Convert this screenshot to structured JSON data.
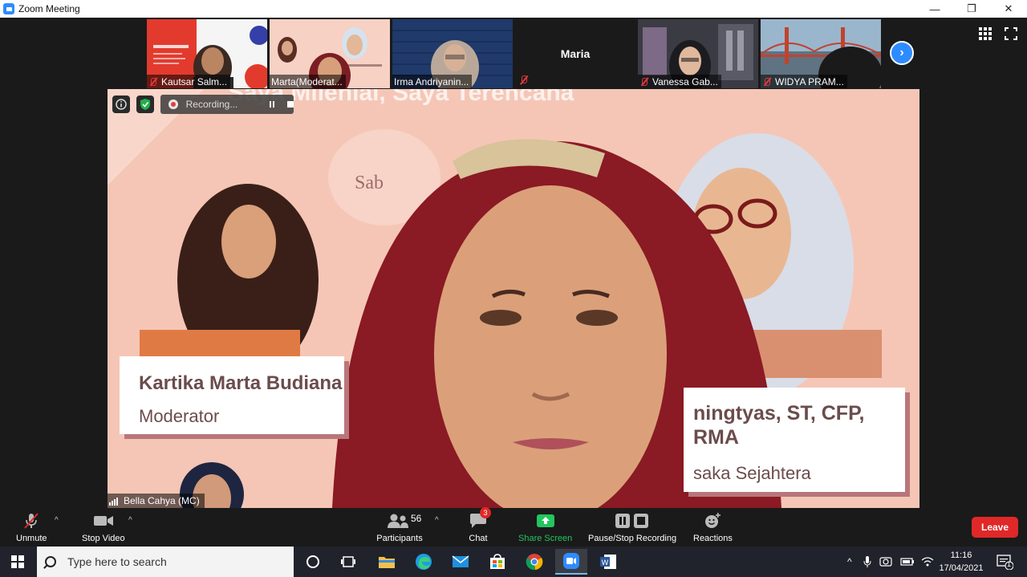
{
  "window": {
    "title": "Zoom Meeting",
    "controls": [
      "—",
      "❐",
      "✕"
    ]
  },
  "thumbnails": [
    {
      "name": "Kautsar Salm...",
      "muted": true
    },
    {
      "name": "Marta(Moderat...",
      "muted": false
    },
    {
      "name": "Irma Andriyanin...",
      "muted": false
    },
    {
      "name": "Maria",
      "muted": true,
      "video_off": true
    },
    {
      "name": "Vanessa Gab...",
      "muted": true
    },
    {
      "name": "WIDYA PRAM...",
      "muted": true
    }
  ],
  "main_video": {
    "speaker_name": "Bella Cahya (MC)",
    "slide": {
      "title": "Saya Milenial, Saya Terencana",
      "sab": "Sab",
      "left_card": {
        "name": "Kartika Marta Budiana",
        "role": "Moderator"
      },
      "right_card": {
        "line1": "ningtyas, ST, CFP,",
        "line2": "RMA",
        "line3": "saka Sejahtera"
      }
    },
    "recording": {
      "label": "Recording..."
    }
  },
  "toolbar": {
    "unmute": "Unmute",
    "stop_video": "Stop Video",
    "participants": "Participants",
    "participant_count": "56",
    "chat": "Chat",
    "chat_badge": "3",
    "share_screen": "Share Screen",
    "pause_stop_recording": "Pause/Stop Recording",
    "reactions": "Reactions",
    "leave": "Leave"
  },
  "taskbar": {
    "search_placeholder": "Type here to search",
    "time": "11:16",
    "date": "17/04/2021",
    "notification_count": "1"
  },
  "colors": {
    "zoom_blue": "#2d8cff",
    "leave_red": "#e02828",
    "share_green": "#22c55e",
    "slide_pink": "#f4c4b4"
  }
}
